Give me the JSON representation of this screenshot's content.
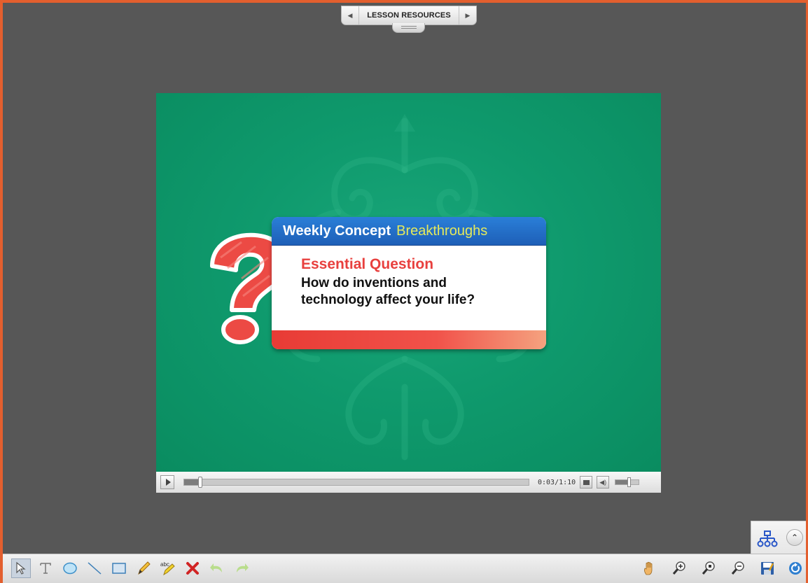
{
  "lesson_tab": {
    "title": "LESSON RESOURCES",
    "prev_icon": "triangle-left",
    "next_icon": "triangle-right"
  },
  "slide": {
    "header_bold": "Weekly Concept",
    "header_light": "Breakthroughs",
    "label": "Essential Question",
    "question": "How do inventions and technology affect your life?",
    "colors": {
      "background": "#0f9a6d",
      "header": "#1e5fb7",
      "accent": "#e8403e",
      "header_accent": "#e6ea5a"
    }
  },
  "player": {
    "time": "0:03/1:10",
    "progress": 0.043,
    "volume": 0.55
  },
  "toolbar": {
    "left_tools": [
      "select",
      "text",
      "ellipse",
      "line",
      "rectangle",
      "pen",
      "spell-highlighter",
      "delete",
      "undo",
      "redo"
    ],
    "right_tools": [
      "pan",
      "zoom-in",
      "zoom-reset",
      "zoom-out",
      "save",
      "refresh"
    ]
  },
  "nav_panel": {
    "collapse_icon": "chevron-up"
  },
  "colors": {
    "frame_border": "#e35f2e",
    "workspace": "#575757"
  }
}
